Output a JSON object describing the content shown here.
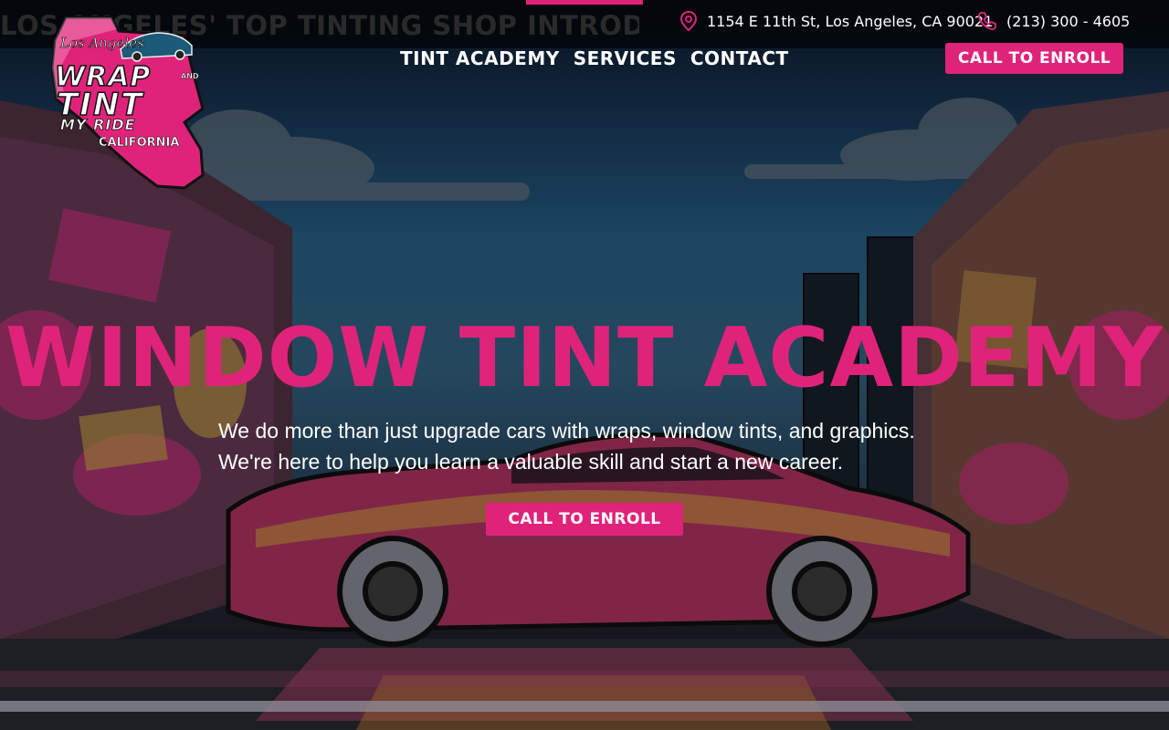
{
  "ticker": {
    "text": "LOS ANGELES' TOP TINTING SHOP INTRODUCES"
  },
  "contact": {
    "address": "1154 E 11th St, Los Angeles, CA 90021",
    "phone": "(213) 300 - 4605",
    "address_icon": "map-pin-icon",
    "phone_icon": "phone-icon"
  },
  "logo": {
    "top_line": "Los Angeles",
    "line1": "WRAP",
    "line1_suffix": "AND",
    "line2": "TINT",
    "line3": "MY RIDE",
    "line4": "CALIFORNIA"
  },
  "nav": {
    "items": [
      {
        "label": "TINT ACADEMY"
      },
      {
        "label": "SERVICES"
      },
      {
        "label": "CONTACT"
      }
    ],
    "cta_label": "CALL TO ENROLL"
  },
  "hero": {
    "title": "WINDOW TINT ACADEMY",
    "line1": "We do more than just upgrade cars with wraps, window tints, and graphics.",
    "line2": "We're here to help you learn a valuable skill and start a new career.",
    "cta_label": "CALL TO ENROLL"
  },
  "colors": {
    "accent": "#e0237a",
    "text": "#ffffff",
    "topbar": "#000000"
  }
}
